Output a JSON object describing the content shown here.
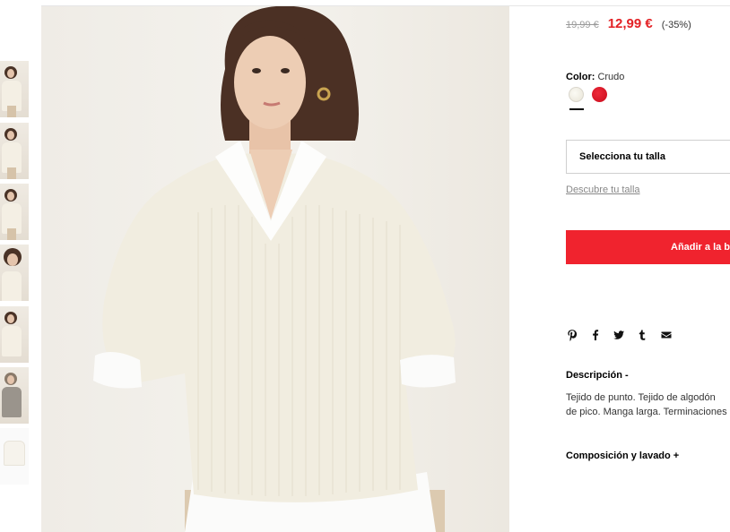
{
  "product": {
    "old_price": "19,99 €",
    "new_price": "12,99 €",
    "discount": "(-35%)",
    "color_label": "Color:",
    "color_name": "Crudo",
    "swatches": [
      "crudo",
      "rojo"
    ],
    "size_select": "Selecciona tu talla",
    "size_link": "Descubre tu talla",
    "add_button": "Añadir a la bolsa"
  },
  "share": [
    "pinterest-icon",
    "facebook-icon",
    "twitter-icon",
    "tumblr-icon",
    "email-icon"
  ],
  "description": {
    "title": "Descripción -",
    "line1": "Tejido de punto. Tejido de algodón",
    "line2": "de pico. Manga larga. Terminaciones"
  },
  "composition": {
    "title": "Composición y lavado +"
  },
  "colors": {
    "accent": "#f0232e",
    "price_red": "#e32125",
    "swatch_cream": "#f2efe4",
    "swatch_red": "#d8141f"
  }
}
